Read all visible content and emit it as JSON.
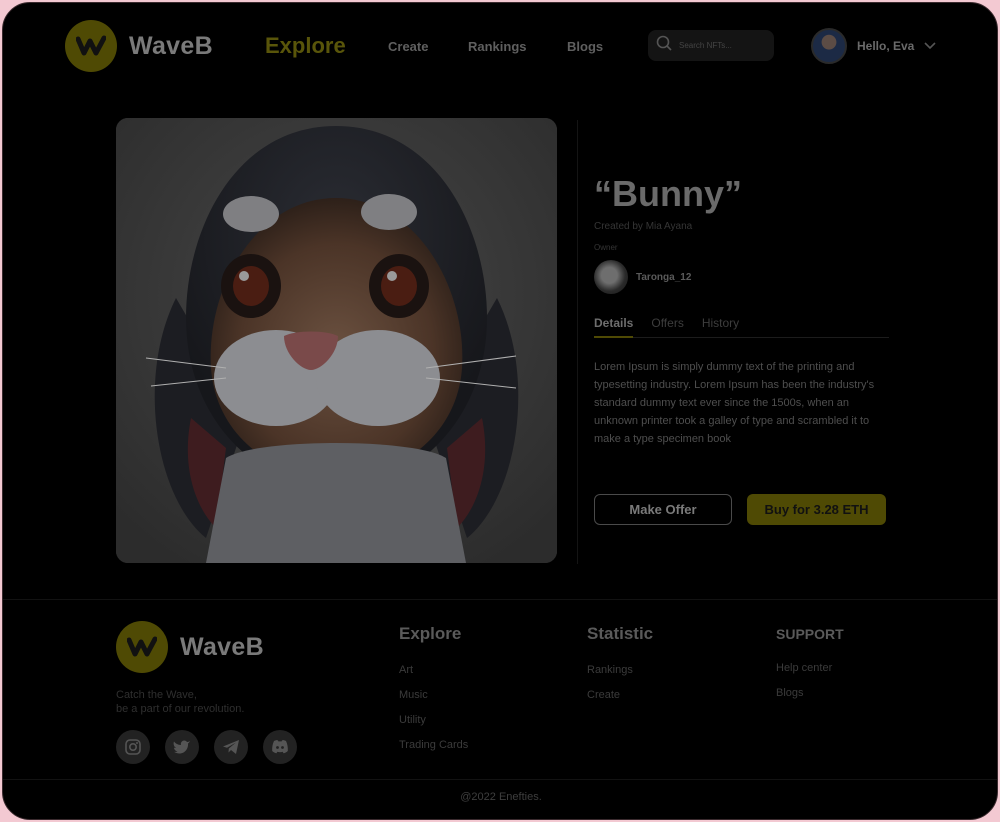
{
  "brand": {
    "name": "WaveB",
    "accent_color": "#4f4a04"
  },
  "nav": {
    "explore": "Explore",
    "items": [
      "Create",
      "Rankings",
      "Blogs"
    ]
  },
  "search": {
    "placeholder": "Search NFTs..."
  },
  "user": {
    "greeting": "Hello, Eva"
  },
  "nft": {
    "title": "“Bunny”",
    "created_by": "Created by Mia Ayana",
    "owner_label": "Owner",
    "owner_name": "Taronga_12",
    "tabs": [
      "Details",
      "Offers",
      "History"
    ],
    "active_tab": "Details",
    "description": "Lorem Ipsum is simply dummy text of the printing and typesetting industry. Lorem Ipsum has been the industry's standard dummy text ever since the 1500s, when an unknown printer took a galley of type and scrambled it to make a type specimen book",
    "make_offer_label": "Make Offer",
    "buy_label": "Buy for 3.28 ETH"
  },
  "footer": {
    "brand": "WaveB",
    "tagline_line1": "Catch the Wave,",
    "tagline_line2": "be a part of our revolution.",
    "socials": [
      "instagram-icon",
      "twitter-icon",
      "telegram-icon",
      "discord-icon"
    ],
    "explore": {
      "heading": "Explore",
      "links": [
        "Art",
        "Music",
        "Utility",
        "Trading Cards"
      ]
    },
    "statistic": {
      "heading": "Statistic",
      "links": [
        "Rankings",
        "Create"
      ]
    },
    "support": {
      "heading": "SUPPORT",
      "links": [
        "Help center",
        "Blogs"
      ]
    },
    "copyright": "@2022 Enefties."
  }
}
